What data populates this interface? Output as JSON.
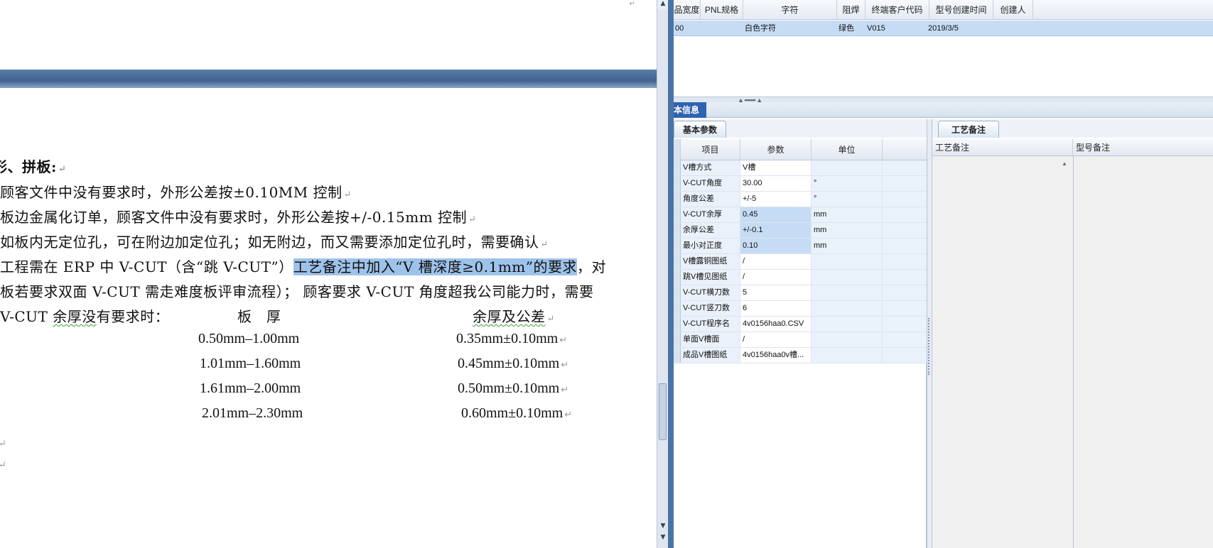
{
  "document": {
    "lines": [
      "形、拼板:",
      "顾客文件中没有要求时，外形公差按±0.10MM 控制",
      "板边金属化订单，顾客文件中没有要求时，外形公差按+/-0.15mm 控制",
      "如板内无定位孔，可在附边加定位孔；如无附边，而又需要添加定位孔时，需要确认"
    ],
    "line5_pre": "工程需在 ERP 中 V-CUT（含“跳 V-CUT”）",
    "line5_hl": "工艺备注中加入“V 槽深度≥0.1mm”的要求",
    "line5_post": "，对",
    "line6": "板若要求双面 V-CUT 需走难度板评审流程）； 顾客要求 V-CUT 角度超我公司能力时，需要",
    "line7_pre": "V-CUT ",
    "line7_squig": "余厚没",
    "line7_post": "有要求时：",
    "vtable_header_left": "板　厚",
    "vtable_header_right": "余厚及公差",
    "vtable_rows": [
      {
        "thickness": "0.50mm–1.00mm",
        "margin": "0.35mm±0.10mm"
      },
      {
        "thickness": "1.01mm–1.60mm",
        "margin": "0.45mm±0.10mm"
      },
      {
        "thickness": "1.61mm–2.00mm",
        "margin": "0.50mm±0.10mm"
      },
      {
        "thickness": "2.01mm–2.30mm",
        "margin": "0.60mm±0.10mm"
      }
    ],
    "pilcrow": "↵"
  },
  "erp": {
    "top_grid": {
      "headers": [
        "品宽度",
        "PNL规格",
        "字符",
        "阻焊",
        "终端客户代码",
        "型号创建时间",
        "创建人"
      ],
      "row": {
        "width": "00",
        "pnl": "",
        "char": "白色字符",
        "mask": "绿色",
        "customer": "V015",
        "created": "2019/3/5",
        "creator": ""
      }
    },
    "info_tab": "本信息",
    "subtab_left": "基本参数",
    "subtab_right": "工艺备注",
    "param_headers": [
      "项目",
      "参数",
      "单位"
    ],
    "params": [
      {
        "item": "V槽方式",
        "value": "V槽",
        "unit": ""
      },
      {
        "item": "V-CUT角度",
        "value": "30.00",
        "unit": "°"
      },
      {
        "item": "角度公差",
        "value": "+/-5",
        "unit": "°"
      },
      {
        "item": "V-CUT余厚",
        "value": "0.45",
        "unit": "mm"
      },
      {
        "item": "余厚公差",
        "value": "+/-0.1",
        "unit": "mm"
      },
      {
        "item": "最小对正度",
        "value": "0.10",
        "unit": "mm"
      },
      {
        "item": "V槽露铜图纸",
        "value": "/",
        "unit": ""
      },
      {
        "item": "跳V槽见图纸",
        "value": "/",
        "unit": ""
      },
      {
        "item": "V-CUT横刀数",
        "value": "5",
        "unit": ""
      },
      {
        "item": "V-CUT竖刀数",
        "value": "6",
        "unit": ""
      },
      {
        "item": "V-CUT程序名",
        "value": "4v0156haa0.CSV",
        "unit": ""
      },
      {
        "item": "单面V槽面",
        "value": "/",
        "unit": ""
      },
      {
        "item": "成品V槽图纸",
        "value": "4v0156haa0v槽...",
        "unit": ""
      }
    ],
    "craft_headers": [
      "工艺备注",
      "型号备注"
    ]
  }
}
